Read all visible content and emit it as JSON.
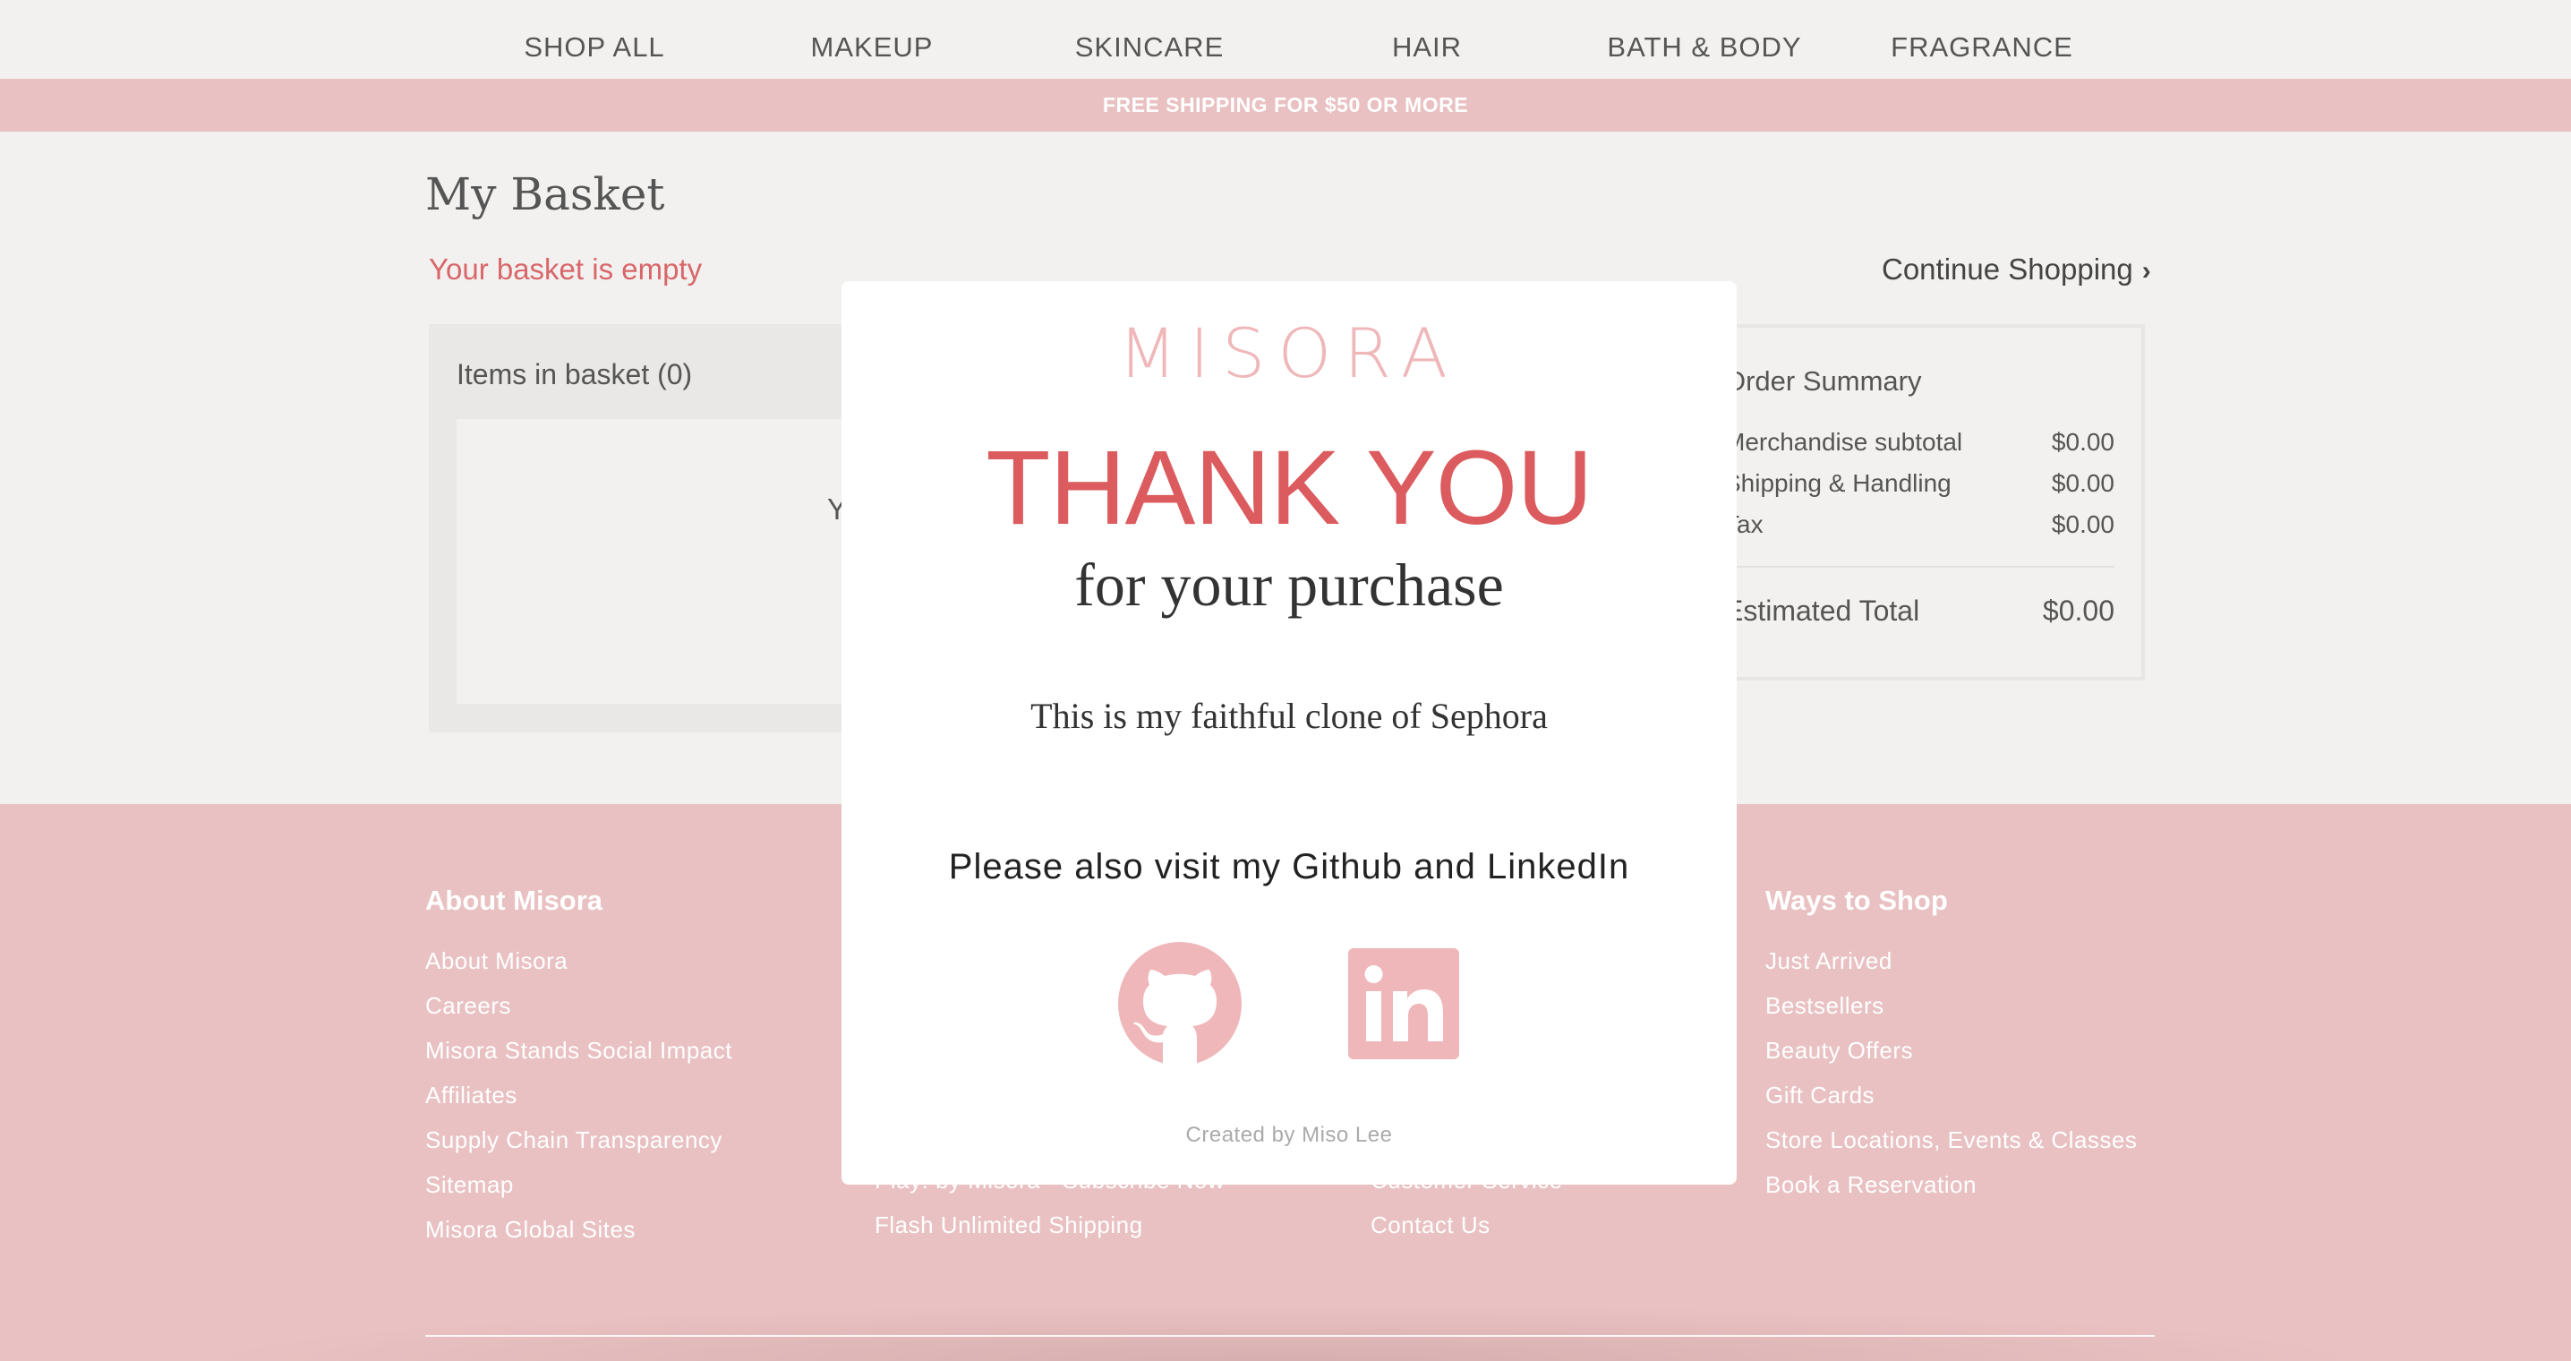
{
  "nav": {
    "items": [
      "SHOP ALL",
      "MAKEUP",
      "SKINCARE",
      "HAIR",
      "BATH & BODY",
      "FRAGRANCE"
    ]
  },
  "promo": {
    "text": "FREE SHIPPING FOR $50 OR MORE"
  },
  "basket": {
    "title": "My Basket",
    "empty_message": "Your basket is empty",
    "continue_label": "Continue Shopping",
    "items_title": "Items in basket (0)",
    "items_inner_text": "You"
  },
  "summary": {
    "title": "Order Summary",
    "rows": [
      {
        "label": "Merchandise subtotal",
        "amount": "$0.00"
      },
      {
        "label": "Shipping & Handling",
        "amount": "$0.00"
      },
      {
        "label": "Tax",
        "amount": "$0.00"
      }
    ],
    "total_label": "Estimated Total",
    "total_amount": "$0.00"
  },
  "footer": {
    "columns": [
      {
        "heading": "About Misora",
        "links": [
          "About Misora",
          "Careers",
          "Misora Stands Social Impact",
          "Affiliates",
          "Supply Chain Transparency",
          "Sitemap",
          "Misora Global Sites"
        ]
      },
      {
        "heading": "",
        "links": [
          "Play! by Misora - Subscribe Now",
          "Flash Unlimited Shipping"
        ]
      },
      {
        "heading": "",
        "links": [
          "Customer Service",
          "Contact Us"
        ]
      },
      {
        "heading": "Ways to Shop",
        "links": [
          "Just Arrived",
          "Bestsellers",
          "Beauty Offers",
          "Gift Cards",
          "Store Locations, Events & Classes",
          "Book a Reservation"
        ]
      }
    ]
  },
  "modal": {
    "logo": "MISORA",
    "thank_you": "THANK YOU",
    "purchase": "for your purchase",
    "clone_note": "This is my faithful clone of Sephora",
    "visit": "Please also visit my Github and LinkedIn",
    "credit": "Created by Miso Lee",
    "github_icon": "github-icon",
    "linkedin_icon": "linkedin-icon"
  },
  "colors": {
    "accent_pink": "#e9c1c2",
    "logo_pink": "#efb7b9",
    "red": "#db5b5e"
  }
}
